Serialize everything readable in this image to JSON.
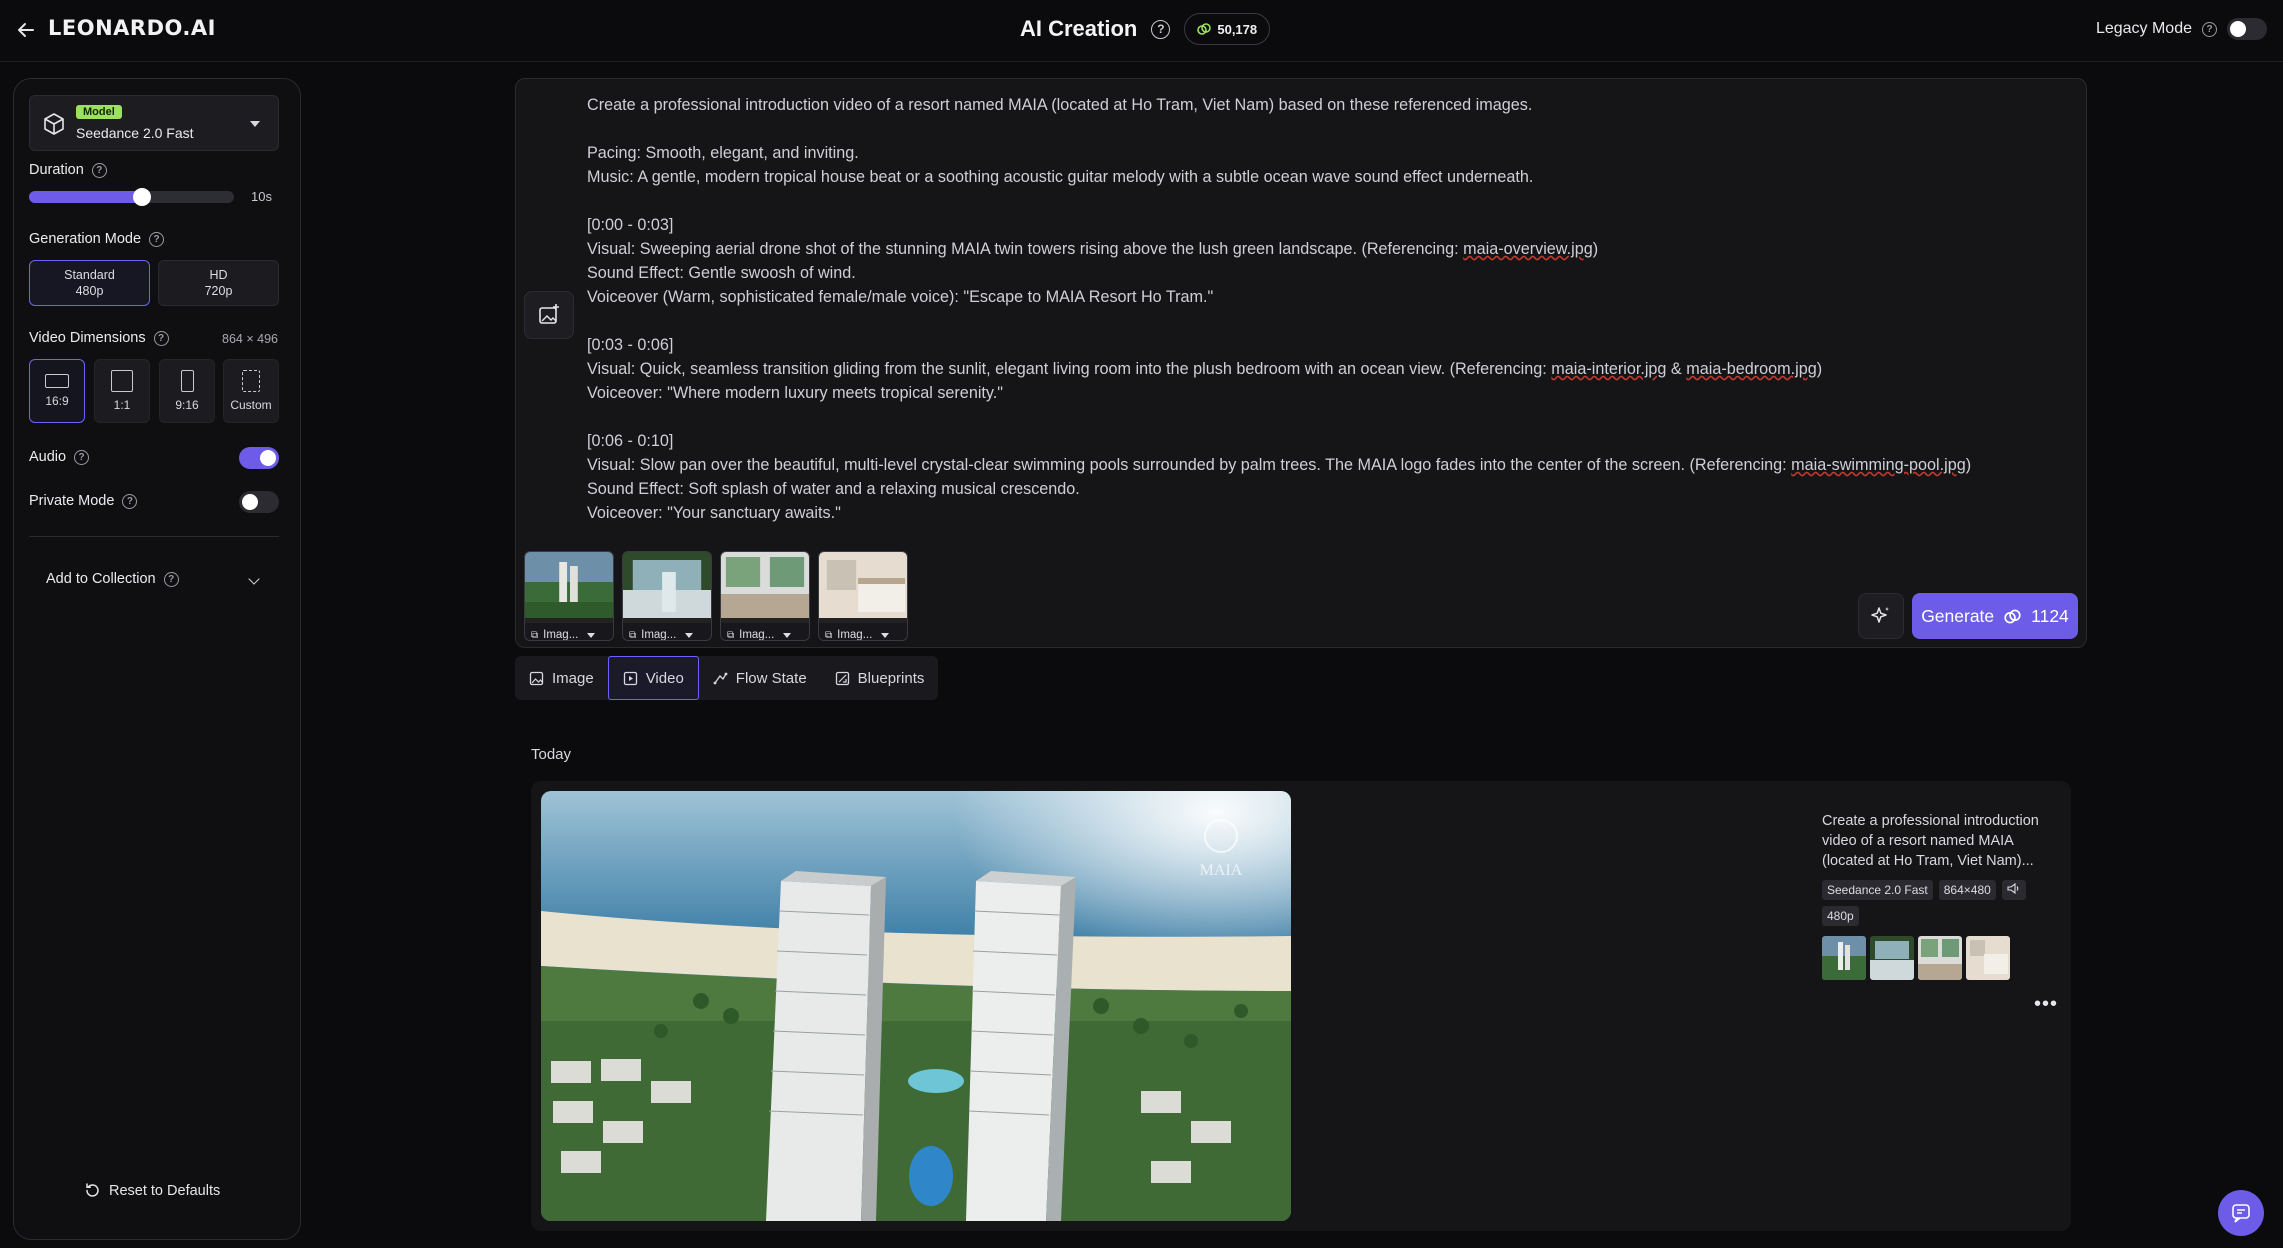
{
  "header": {
    "logo": "LEONARDO.AI",
    "title": "AI Creation",
    "tokens": "50,178",
    "legacy_mode_label": "Legacy Mode"
  },
  "sidebar": {
    "model_badge": "Model",
    "model_name": "Seedance 2.0 Fast",
    "duration_label": "Duration",
    "duration_value": "10s",
    "duration_fraction": 0.55,
    "generation_mode_label": "Generation Mode",
    "modes": [
      {
        "title": "Standard",
        "sub": "480p",
        "selected": true
      },
      {
        "title": "HD",
        "sub": "720p",
        "selected": false
      }
    ],
    "video_dimensions_label": "Video Dimensions",
    "video_dimensions_value": "864 × 496",
    "dimensions": [
      {
        "label": "16:9",
        "selected": true
      },
      {
        "label": "1:1",
        "selected": false
      },
      {
        "label": "9:16",
        "selected": false
      },
      {
        "label": "Custom",
        "selected": false
      }
    ],
    "audio_label": "Audio",
    "audio_on": true,
    "private_mode_label": "Private Mode",
    "private_mode_on": false,
    "add_to_collection_label": "Add to Collection",
    "reset_label": "Reset to Defaults"
  },
  "prompt": {
    "line1": "Create a professional introduction video of a resort named MAIA (located at Ho Tram, Viet Nam) based on these referenced images.",
    "pacing": "Pacing: Smooth, elegant, and inviting.",
    "music": "Music: A gentle, modern tropical house beat or a soothing acoustic guitar melody with a subtle ocean wave sound effect underneath.",
    "s1_time": "[0:00 - 0:03]",
    "s1_visual": "Visual: Sweeping aerial drone shot of the stunning MAIA twin towers rising above the lush green landscape. (Referencing: ",
    "s1_ref": "maia-overview.jpg",
    "s1_close": ")",
    "s1_sfx": "Sound Effect: Gentle swoosh of wind.",
    "s1_vo": "Voiceover (Warm, sophisticated female/male voice): \"Escape to MAIA Resort Ho Tram.\"",
    "s2_time": "[0:03 - 0:06]",
    "s2_visual": "Visual: Quick, seamless transition gliding from the sunlit, elegant living room into the plush bedroom with an ocean view. (Referencing: ",
    "s2_ref1": "maia-interior.jpg",
    "s2_amp": " & ",
    "s2_ref2": "maia-bedroom.jpg",
    "s2_close": ")",
    "s2_vo": "Voiceover: \"Where modern luxury meets tropical serenity.\"",
    "s3_time": "[0:06 - 0:10]",
    "s3_visual": "Visual: Slow pan over the beautiful, multi-level crystal-clear swimming pools surrounded by palm trees. The MAIA logo fades into the center of the screen. (Referencing: ",
    "s3_ref": "maia-swimming-pool.jpg",
    "s3_close": ")",
    "s3_sfx": "Sound Effect: Soft splash of water and a relaxing musical crescendo.",
    "s3_vo": "Voiceover: \"Your sanctuary awaits.\"",
    "thumb_label": "Imag...",
    "generate_label": "Generate",
    "generate_cost": "1124"
  },
  "tabs": [
    {
      "label": "Image",
      "icon": "image-icon",
      "selected": false
    },
    {
      "label": "Video",
      "icon": "video-icon",
      "selected": true
    },
    {
      "label": "Flow State",
      "icon": "flow-icon",
      "selected": false
    },
    {
      "label": "Blueprints",
      "icon": "blueprint-icon",
      "selected": false
    }
  ],
  "feed": {
    "section": "Today",
    "card_desc": "Create a professional introduction video of a resort named MAIA (located at Ho Tram, Viet Nam)...",
    "chips": [
      "Seedance 2.0 Fast",
      "864×480",
      "480p"
    ],
    "video_overlay_text": "MAIA"
  },
  "colors": {
    "accent": "#6c5ce7",
    "model_badge": "#9be15d",
    "background": "#0b0b0d"
  }
}
